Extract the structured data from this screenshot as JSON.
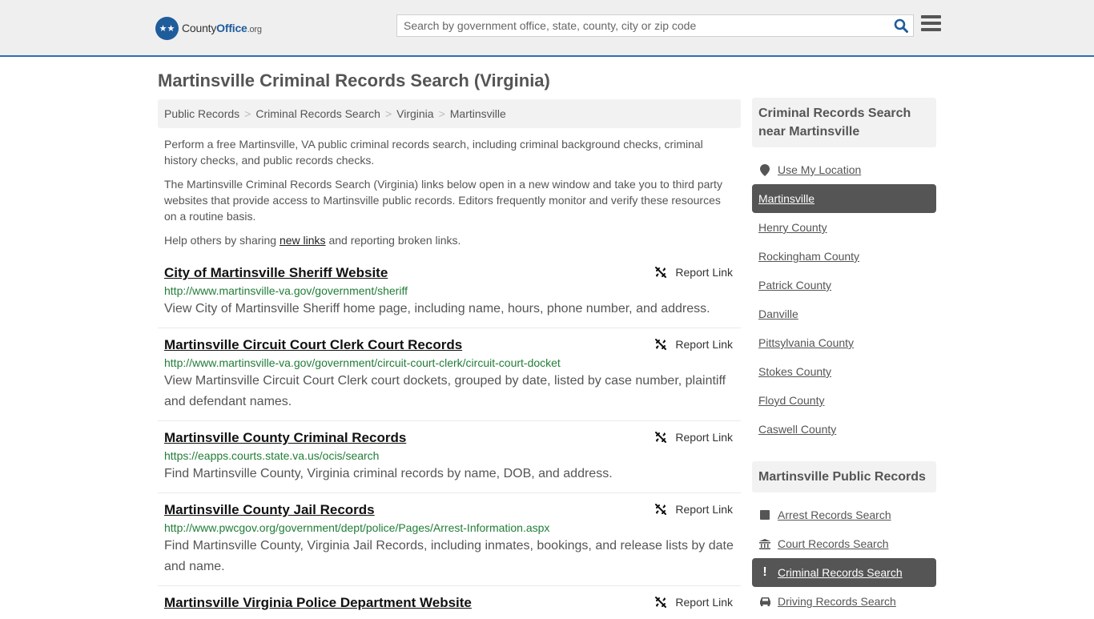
{
  "header": {
    "logo_text_county": "County",
    "logo_text_office": "Office",
    "logo_text_org": ".org",
    "search_placeholder": "Search by government office, state, county, city or zip code",
    "search_icon": "search-icon",
    "menu_icon": "hamburger-menu-icon"
  },
  "page": {
    "title": "Martinsville Criminal Records Search (Virginia)"
  },
  "breadcrumb": [
    {
      "label": "Public Records"
    },
    {
      "label": "Criminal Records Search"
    },
    {
      "label": "Virginia"
    },
    {
      "label": "Martinsville"
    }
  ],
  "breadcrumb_separator": ">",
  "intro": {
    "p1": "Perform a free Martinsville, VA public criminal records search, including criminal background checks, criminal history checks, and public records checks.",
    "p2": "The Martinsville Criminal Records Search (Virginia) links below open in a new window and take you to third party websites that provide access to Martinsville public records. Editors frequently monitor and verify these resources on a routine basis.",
    "p3_before": "Help others by sharing ",
    "p3_link": "new links",
    "p3_after": " and reporting broken links."
  },
  "report_label": "Report Link",
  "results": [
    {
      "title": "City of Martinsville Sheriff Website",
      "url": "http://www.martinsville-va.gov/government/sheriff",
      "description": "View City of Martinsville Sheriff home page, including name, hours, phone number, and address."
    },
    {
      "title": "Martinsville Circuit Court Clerk Court Records",
      "url": "http://www.martinsville-va.gov/government/circuit-court-clerk/circuit-court-docket",
      "description": "View Martinsville Circuit Court Clerk court dockets, grouped by date, listed by case number, plaintiff and defendant names."
    },
    {
      "title": "Martinsville County Criminal Records",
      "url": "https://eapps.courts.state.va.us/ocis/search",
      "description": "Find Martinsville County, Virginia criminal records by name, DOB, and address."
    },
    {
      "title": "Martinsville County Jail Records",
      "url": "http://www.pwcgov.org/government/dept/police/Pages/Arrest-Information.aspx",
      "description": "Find Martinsville County, Virginia Jail Records, including inmates, bookings, and release lists by date and name."
    },
    {
      "title": "Martinsville Virginia Police Department Website",
      "url": "",
      "description": ""
    }
  ],
  "sidebar": {
    "nearby_heading": "Criminal Records Search near Martinsville",
    "use_location": "Use My Location",
    "nearby": [
      {
        "label": "Martinsville",
        "active": true
      },
      {
        "label": "Henry County"
      },
      {
        "label": "Rockingham County"
      },
      {
        "label": "Patrick County"
      },
      {
        "label": "Danville"
      },
      {
        "label": "Pittsylvania County"
      },
      {
        "label": "Stokes County"
      },
      {
        "label": "Floyd County"
      },
      {
        "label": "Caswell County"
      }
    ],
    "public_heading": "Martinsville Public Records",
    "public": [
      {
        "label": "Arrest Records Search",
        "icon": "square-icon"
      },
      {
        "label": "Court Records Search",
        "icon": "courthouse-icon"
      },
      {
        "label": "Criminal Records Search",
        "icon": "exclamation-icon",
        "active": true
      },
      {
        "label": "Driving Records Search",
        "icon": "car-icon"
      }
    ]
  },
  "colors": {
    "accent_blue": "#1f5c9c",
    "url_green": "#217d37",
    "active_bg": "#555555"
  }
}
